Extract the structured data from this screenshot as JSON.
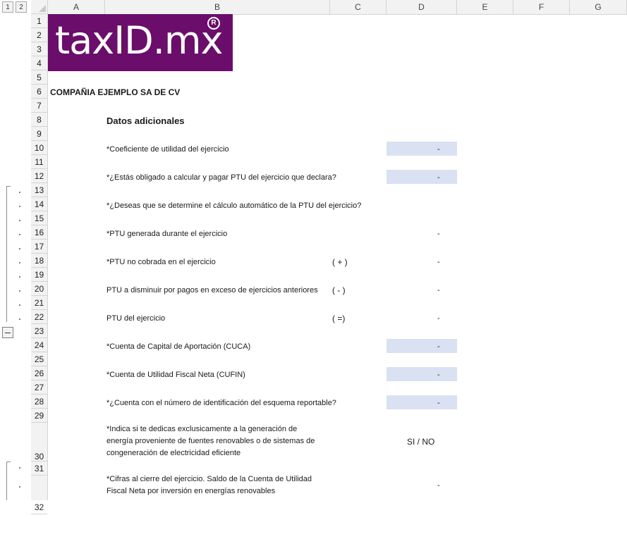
{
  "outline": {
    "level1": "1",
    "level2": "2"
  },
  "columns": [
    "A",
    "B",
    "C",
    "D",
    "E",
    "F",
    "G"
  ],
  "rows": [
    "1",
    "2",
    "3",
    "4",
    "5",
    "6",
    "7",
    "8",
    "9",
    "10",
    "11",
    "12",
    "13",
    "14",
    "15",
    "16",
    "17",
    "18",
    "19",
    "20",
    "21",
    "22",
    "23",
    "24",
    "25",
    "26",
    "27",
    "28",
    "29",
    "30",
    "31",
    "32"
  ],
  "logo": {
    "text": "taxID.mx",
    "reg": "R"
  },
  "company": "COMPAÑIA EJEMPLO SA DE CV",
  "section_title": "Datos adicionales",
  "lines": {
    "r10": "*Coeficiente de utilidad del ejercicio",
    "r12": "*¿Estás obligado a calcular y pagar PTU del ejercicio que declara?",
    "r14": "*¿Deseas que se determine el cálculo automático de la PTU del ejercicio?",
    "r16": "*PTU generada durante el ejercicio",
    "r18": "*PTU no cobrada en el ejercicio",
    "r20": "PTU a disminuir por pagos en exceso de ejercicios anteriores",
    "r22": "PTU del ejercicio",
    "r24": "*Cuenta de Capital de Aportación (CUCA)",
    "r26": "*Cuenta de Utilidad Fiscal Neta (CUFIN)",
    "r28": "*¿Cuenta con el número de identificación del esquema reportable?",
    "r30a": "*Indica si te dedicas exclusicamente a la generación de",
    "r30b": "energía proveniente de fuentes renovables o de sistemas de",
    "r30c": "congeneración de electricidad eficiente",
    "r32a": "*Cifras al cierre del ejercicio. Saldo de la Cuenta de Utilidad",
    "r32b": "Fiscal Neta por inversión en energías renovables"
  },
  "operators": {
    "r18": "( + )",
    "r20": "( - )",
    "r22": "( =)"
  },
  "values": {
    "r10": "-",
    "r12": "-",
    "r16": "-",
    "r18": "-",
    "r20": "-",
    "r22": "-",
    "r24": "-",
    "r26": "-",
    "r28": "-",
    "r30": "SI / NO",
    "r32": "-"
  },
  "colors": {
    "input_fill": "#d9e1f2",
    "logo_bg": "#6b0d6b"
  }
}
